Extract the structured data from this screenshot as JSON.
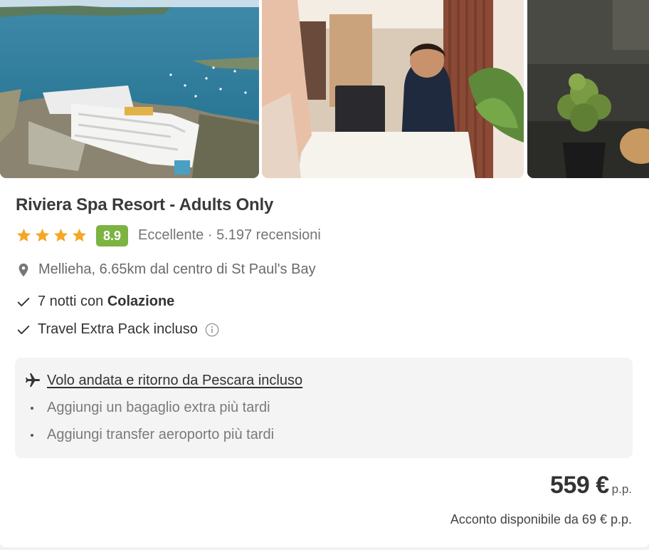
{
  "gallery": {
    "photos": [
      {
        "icon": "resort-aerial-photo"
      },
      {
        "icon": "reception-desk-photo"
      },
      {
        "icon": "plant-photo"
      }
    ]
  },
  "hotel": {
    "name": "Riviera Spa Resort - Adults Only",
    "stars": 4,
    "score": "8.9",
    "rating_text": "Eccellente · 5.197 recensioni",
    "location": "Mellieha, 6.65km dal centro di St Paul's Bay"
  },
  "inclusions": {
    "nights_prefix": "7 notti con ",
    "nights_board": "Colazione",
    "pack": "Travel Extra Pack incluso"
  },
  "flight": {
    "link": "Volo andata e ritorno da Pescara incluso",
    "addons": [
      "Aggiungi un bagaglio extra più tardi",
      "Aggiungi transfer aeroporto più tardi"
    ]
  },
  "price": {
    "amount": "559 €",
    "unit": "p.p.",
    "deposit": "Acconto disponibile da 69 € p.p."
  },
  "colors": {
    "score_badge": "#7cb342",
    "star": "#f5a623",
    "box_bg": "#f4f4f4"
  }
}
